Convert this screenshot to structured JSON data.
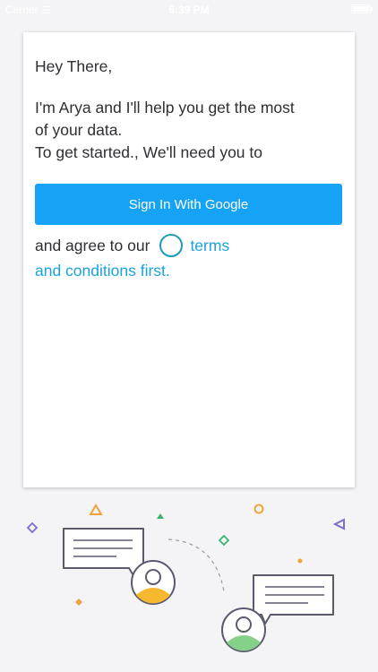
{
  "status_bar": {
    "carrier": "Carrier",
    "time": "6:39 PM"
  },
  "card": {
    "greeting": "Hey There,",
    "intro_line_1": "I'm Arya and I'll help you get the most",
    "intro_line_2": "of your data.",
    "intro_line_3": "To get started., We'll need you to",
    "sign_in_button": "Sign In With Google",
    "agree_prefix": "and agree to our",
    "terms_part_1": "terms",
    "terms_part_2": "and conditions first."
  },
  "colors": {
    "primary_button": "#16a3f6",
    "link": "#1aa3dc",
    "checkbox_ring": "#1f9bb8",
    "avatar_yellow": "#f5b82e",
    "avatar_green": "#86d18a",
    "accent_orange": "#f2a23a",
    "accent_green": "#3cb371",
    "accent_purple": "#7b6fc9"
  },
  "illustration": {
    "icons": [
      "chat-bubble-icon",
      "user-avatar-icon",
      "triangle-icon",
      "diamond-icon",
      "circle-icon",
      "dot-icon"
    ]
  }
}
